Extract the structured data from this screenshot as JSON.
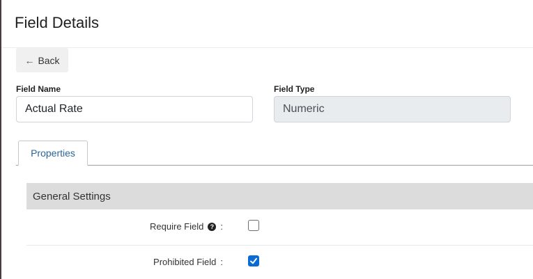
{
  "page": {
    "title": "Field Details"
  },
  "back_button": {
    "arrow": "←",
    "label": "Back"
  },
  "fields": {
    "name": {
      "label": "Field Name",
      "value": "Actual Rate"
    },
    "type": {
      "label": "Field Type",
      "value": "Numeric"
    }
  },
  "tabs": [
    {
      "label": "Properties",
      "active": true
    }
  ],
  "general_settings": {
    "title": "General Settings",
    "rows": [
      {
        "label": "Require Field",
        "help_icon": "?",
        "colon": ":",
        "checked": false
      },
      {
        "label": "Prohibited Field",
        "colon": ":",
        "checked": true
      }
    ]
  },
  "colors": {
    "checkbox_checked": "#0b6bd6",
    "tab_text": "#2a6496",
    "section_bg": "#dcdcdc"
  }
}
